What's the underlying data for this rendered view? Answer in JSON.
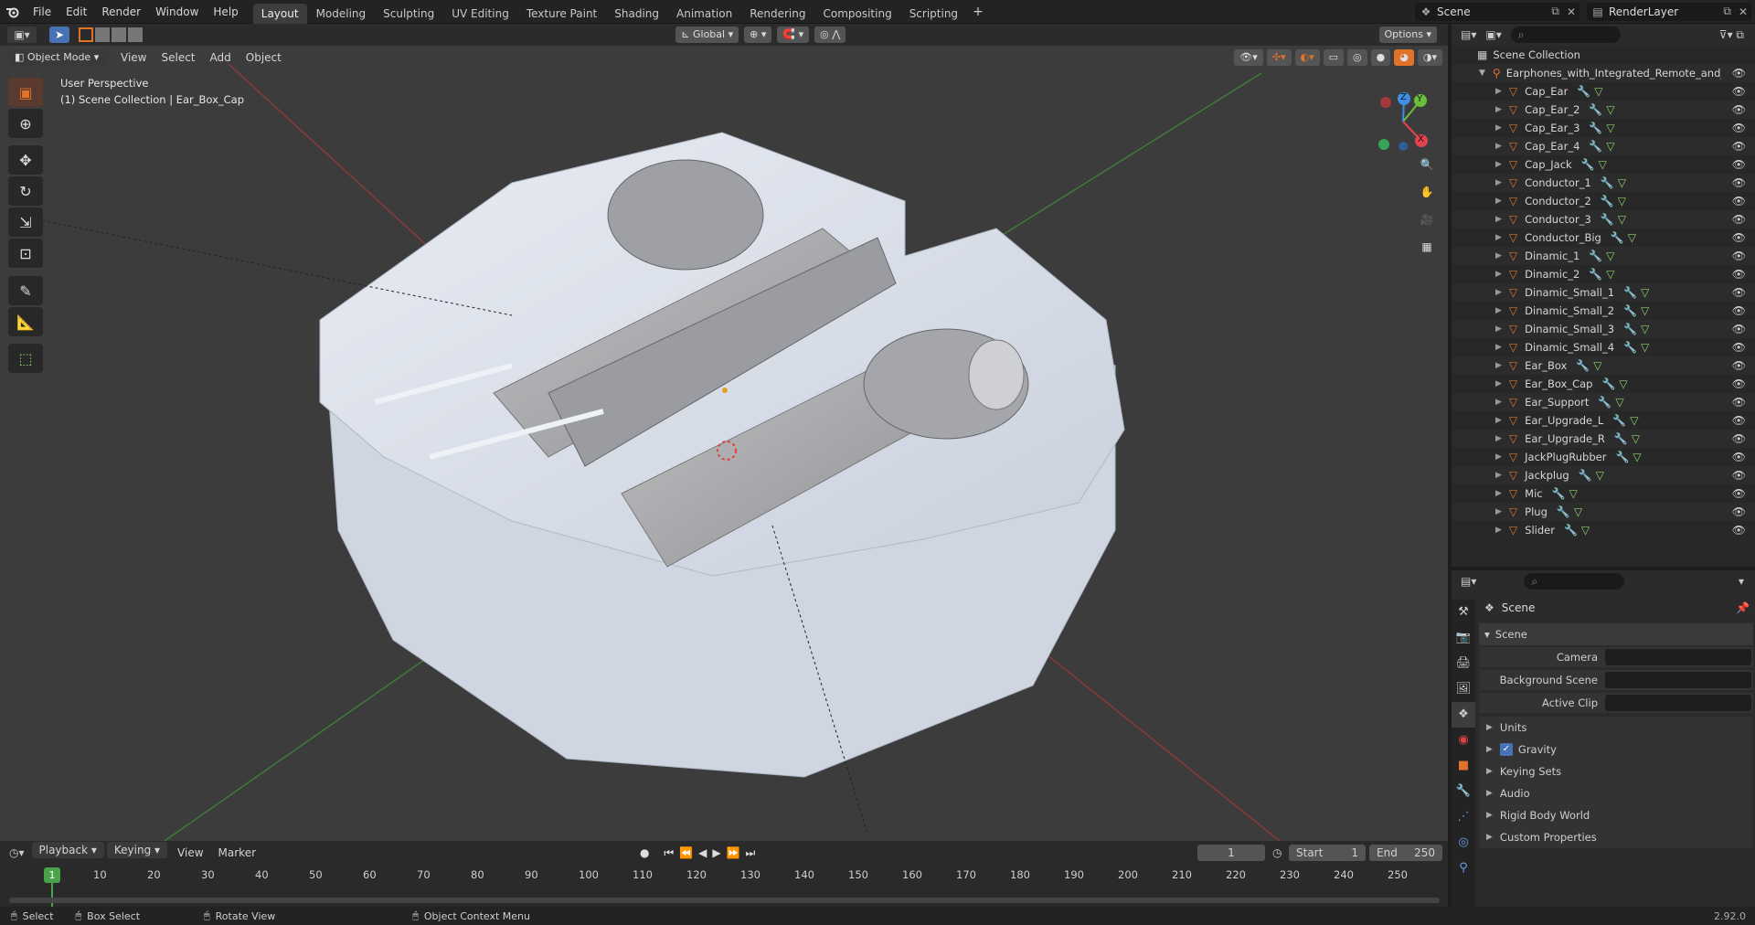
{
  "topbar": {
    "menus": [
      "File",
      "Edit",
      "Render",
      "Window",
      "Help"
    ],
    "workspaces": [
      "Layout",
      "Modeling",
      "Sculpting",
      "UV Editing",
      "Texture Paint",
      "Shading",
      "Animation",
      "Rendering",
      "Compositing",
      "Scripting"
    ],
    "active_workspace": "Layout",
    "add_tab": "+",
    "scene": "Scene",
    "view_layer": "RenderLayer"
  },
  "viewport_header": {
    "mode": "Object Mode",
    "menus": [
      "View",
      "Select",
      "Add",
      "Object"
    ],
    "orientation": "Global",
    "options": "Options"
  },
  "viewport": {
    "perspective": "User Perspective",
    "context": "(1) Scene Collection | Ear_Box_Cap",
    "gizmo": {
      "x": "X",
      "y": "Y",
      "z": "Z"
    }
  },
  "outliner": {
    "root": "Scene Collection",
    "collection": "Earphones_with_Integrated_Remote_and_Mi",
    "objects": [
      "Cap_Ear",
      "Cap_Ear_2",
      "Cap_Ear_3",
      "Cap_Ear_4",
      "Cap_Jack",
      "Conductor_1",
      "Conductor_2",
      "Conductor_3",
      "Conductor_Big",
      "Dinamic_1",
      "Dinamic_2",
      "Dinamic_Small_1",
      "Dinamic_Small_2",
      "Dinamic_Small_3",
      "Dinamic_Small_4",
      "Ear_Box",
      "Ear_Box_Cap",
      "Ear_Support",
      "Ear_Upgrade_L",
      "Ear_Upgrade_R",
      "JackPlugRubber",
      "Jackplug",
      "Mic",
      "Plug",
      "Slider"
    ]
  },
  "properties": {
    "context": "Scene",
    "panel": "Scene",
    "fields": [
      {
        "label": "Camera",
        "value": ""
      },
      {
        "label": "Background Scene",
        "value": ""
      },
      {
        "label": "Active Clip",
        "value": ""
      }
    ],
    "sections": [
      "Units",
      "Gravity",
      "Keying Sets",
      "Audio",
      "Rigid Body World",
      "Custom Properties"
    ],
    "gravity_checked": true
  },
  "timeline": {
    "menus": [
      "Playback",
      "Keying",
      "View",
      "Marker"
    ],
    "current_frame": "1",
    "start_label": "Start",
    "start": "1",
    "end_label": "End",
    "end": "250",
    "ticks": [
      "10",
      "20",
      "30",
      "40",
      "50",
      "60",
      "70",
      "80",
      "90",
      "100",
      "110",
      "120",
      "130",
      "140",
      "150",
      "160",
      "170",
      "180",
      "190",
      "200",
      "210",
      "220",
      "230",
      "240",
      "250"
    ]
  },
  "statusbar": {
    "items": [
      "Select",
      "Box Select",
      "Rotate View",
      "Object Context Menu"
    ],
    "version": "2.92.0"
  },
  "colors": {
    "accent": "#e0722a",
    "selection": "#4772b3",
    "x_axis": "#e2434f",
    "y_axis": "#6cbf3a",
    "z_axis": "#3f8fe6"
  }
}
